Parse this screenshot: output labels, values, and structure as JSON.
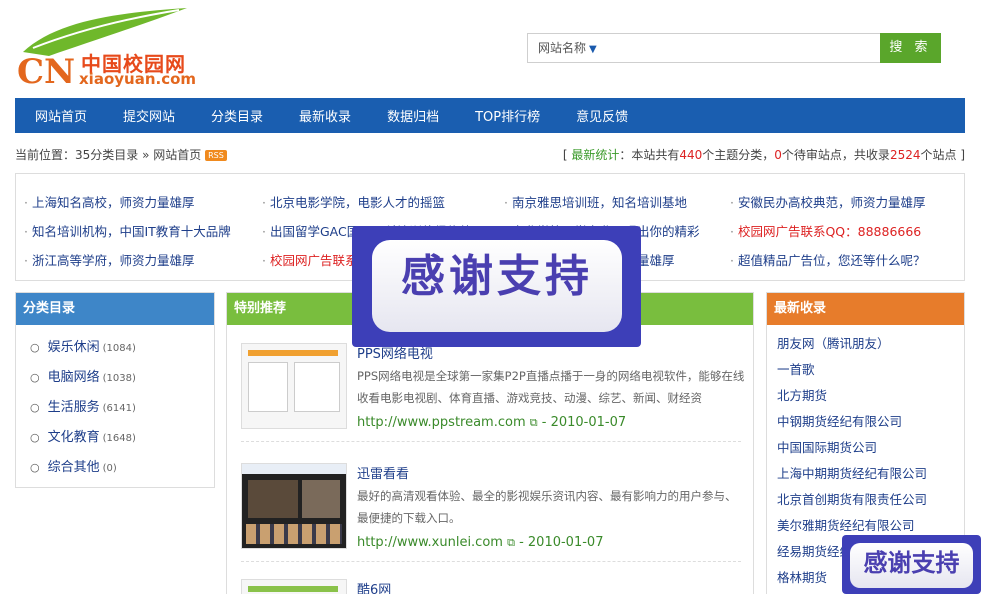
{
  "logo": {
    "cn": "CN",
    "zh": "中国校园网",
    "en": "xiaoyuan.com"
  },
  "search": {
    "category": "网站名称",
    "placeholder": "",
    "button": "搜 索"
  },
  "nav": [
    "网站首页",
    "提交网站",
    "分类目录",
    "最新收录",
    "数据归档",
    "TOP排行榜",
    "意见反馈"
  ],
  "breadcrumb": {
    "prefix": "当前位置：",
    "site": "35分类目录",
    "sep": " » ",
    "page": "网站首页",
    "rss": "RSS"
  },
  "stats": {
    "label": "最新统计",
    "t1": "：本站共有",
    "categories": "440",
    "t2": "个主题分类，",
    "pending": "0",
    "t3": "个待审站点，共收录",
    "sites": "2524",
    "t4": "个站点"
  },
  "links": [
    [
      "上海知名高校，师资力量雄厚",
      "北京电影学院，电影人才的摇篮",
      "南京雅思培训班，知名培训基地",
      "安徽民办高校典范，师资力量雄厚"
    ],
    [
      "知名培训机构，中国IT教育十大品牌",
      "出国留学GAC国际预科培训值得信赖",
      "专业学校，学专业，唱出你的精彩",
      "校园网广告联系QQ：88886666"
    ],
    [
      "浙江高等学府，师资力量雄厚",
      "校园网广告联系QQ：88886666",
      "上海知名高校，师资力量雄厚",
      "超值精品广告位，您还等什么呢？"
    ]
  ],
  "categories": {
    "title": "分类目录",
    "items": [
      {
        "name": "娱乐休闲",
        "count": "(1084)"
      },
      {
        "name": "电脑网络",
        "count": "(1038)"
      },
      {
        "name": "生活服务",
        "count": "(6141)"
      },
      {
        "name": "文化教育",
        "count": "(1648)"
      },
      {
        "name": "综合其他",
        "count": "(0)"
      }
    ]
  },
  "recommend": {
    "title": "特别推荐",
    "items": [
      {
        "name": "PPS网络电视",
        "desc": "PPS网络电视是全球第一家集P2P直播点播于一身的网络电视软件，能够在线收看电影电视剧、体育直播、游戏竞技、动漫、综艺、新闻、财经资",
        "url": "http://www.ppstream.com",
        "date": " - 2010-01-07"
      },
      {
        "name": "迅雷看看",
        "desc": "最好的高清观看体验、最全的影视娱乐资讯内容、最有影响力的用户参与、最便捷的下载入口。",
        "url": "http://www.xunlei.com",
        "date": " - 2010-01-07"
      },
      {
        "name": "酷6网",
        "desc": "",
        "url": "",
        "date": ""
      }
    ]
  },
  "newest": {
    "title": "最新收录",
    "items": [
      "朋友网（腾讯朋友）",
      "一首歌",
      "北方期货",
      "中钢期货经纪有限公司",
      "中国国际期货公司",
      "上海中期期货经纪有限公司",
      "北京首创期货有限责任公司",
      "美尔雅期货经纪有限公司",
      "经易期货经纪有限公司",
      "格林期货"
    ]
  },
  "overlay": {
    "text": "感谢支持"
  }
}
